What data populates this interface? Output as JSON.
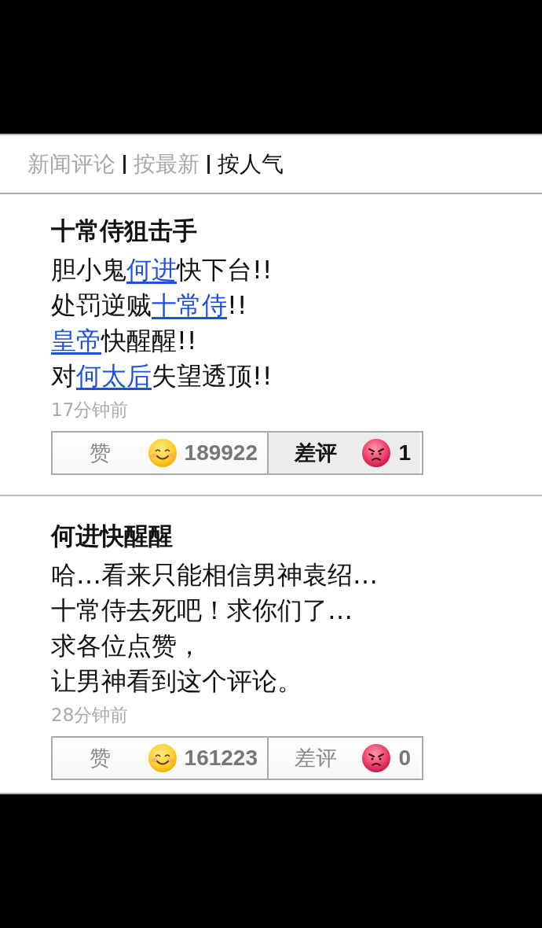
{
  "header": {
    "title": "新闻评论",
    "sort_tabs": [
      {
        "label": "按最新",
        "selected": false
      },
      {
        "label": "按人气",
        "selected": true
      }
    ]
  },
  "comments": [
    {
      "author": "十常侍狙击手",
      "lines": [
        [
          {
            "text": "胆小鬼",
            "link": false
          },
          {
            "text": "何进",
            "link": true
          },
          {
            "text": "快下台!!",
            "link": false
          }
        ],
        [
          {
            "text": "处罚逆贼",
            "link": false
          },
          {
            "text": "十常侍",
            "link": true
          },
          {
            "text": "!!",
            "link": false
          }
        ],
        [
          {
            "text": "皇帝",
            "link": true
          },
          {
            "text": "快醒醒!!",
            "link": false
          }
        ],
        [
          {
            "text": "对",
            "link": false
          },
          {
            "text": "何太后",
            "link": true
          },
          {
            "text": "失望透顶!!",
            "link": false
          }
        ]
      ],
      "time": "17分钟前",
      "votes": [
        {
          "kind": "like",
          "label": "赞",
          "count": "189922",
          "selected": false
        },
        {
          "kind": "dislike",
          "label": "差评",
          "count": "1",
          "selected": true
        }
      ]
    },
    {
      "author": "何进快醒醒",
      "lines": [
        [
          {
            "text": "哈…看来只能相信男神袁绍…",
            "link": false
          }
        ],
        [
          {
            "text": "十常侍去死吧！求你们了…",
            "link": false
          }
        ],
        [
          {
            "text": "求各位点赞，",
            "link": false
          }
        ],
        [
          {
            "text": "让男神看到这个评论。",
            "link": false
          }
        ]
      ],
      "time": "28分钟前",
      "votes": [
        {
          "kind": "like",
          "label": "赞",
          "count": "161223",
          "selected": false
        },
        {
          "kind": "dislike",
          "label": "差评",
          "count": "0",
          "selected": false
        }
      ]
    }
  ]
}
